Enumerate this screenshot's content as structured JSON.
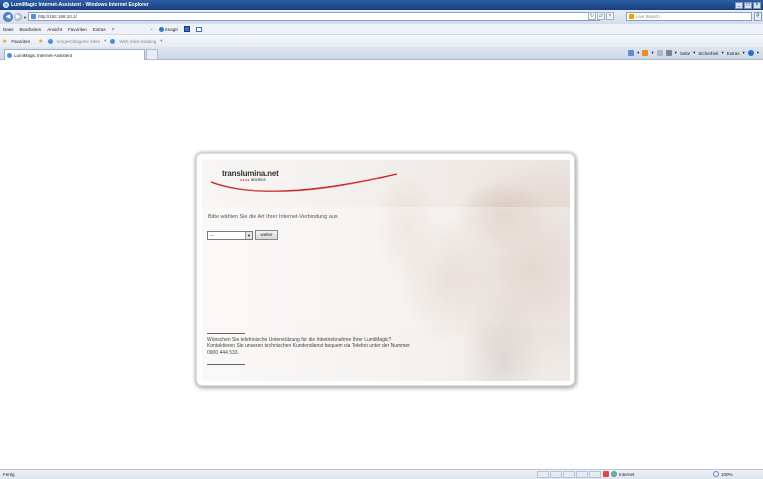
{
  "window": {
    "title": "LumiMagic Internet-Assistent - Windows Internet Explorer"
  },
  "address_bar": {
    "url": "http://192.168.10.1/",
    "search_placeholder": "Live Search"
  },
  "menu": {
    "items": [
      "Datei",
      "Bearbeiten",
      "Ansicht",
      "Favoriten",
      "Extras",
      "?"
    ],
    "snagit_label": "SnagIt"
  },
  "favorites_bar": {
    "label": "Favoriten",
    "suggested_sites": "Vorgeschlagene Sites",
    "web_slice_gallery": "Web Slice-Katalog"
  },
  "tabs": [
    {
      "label": "LumiMagic Internet-Assistent"
    }
  ],
  "command_bar": {
    "page": "Seite",
    "safety": "Sicherheit",
    "tools": "Extras"
  },
  "page": {
    "brand": "translumina.net",
    "brand_sub_dots": "●●●●",
    "brand_sub_text": "WORKS",
    "instruction": "Bitte wählen Sie die Art Ihrer Internet-Verbindung aus",
    "select_value": "---",
    "next_button": "weiter",
    "support_text": "Wünschen Sie telefonische Unterstützung für die Inbetriebnahme Ihrer LumiMagic? Kontaktieren Sie unseren technischen Kundendienst bequem via Telefon unter der Nummer 0900 444 533."
  },
  "status_bar": {
    "status": "Fertig",
    "zone": "Internet",
    "zoom": "100%"
  },
  "colors": {
    "ie_blue": "#2c5fa8",
    "brand_red": "#d0201e"
  }
}
